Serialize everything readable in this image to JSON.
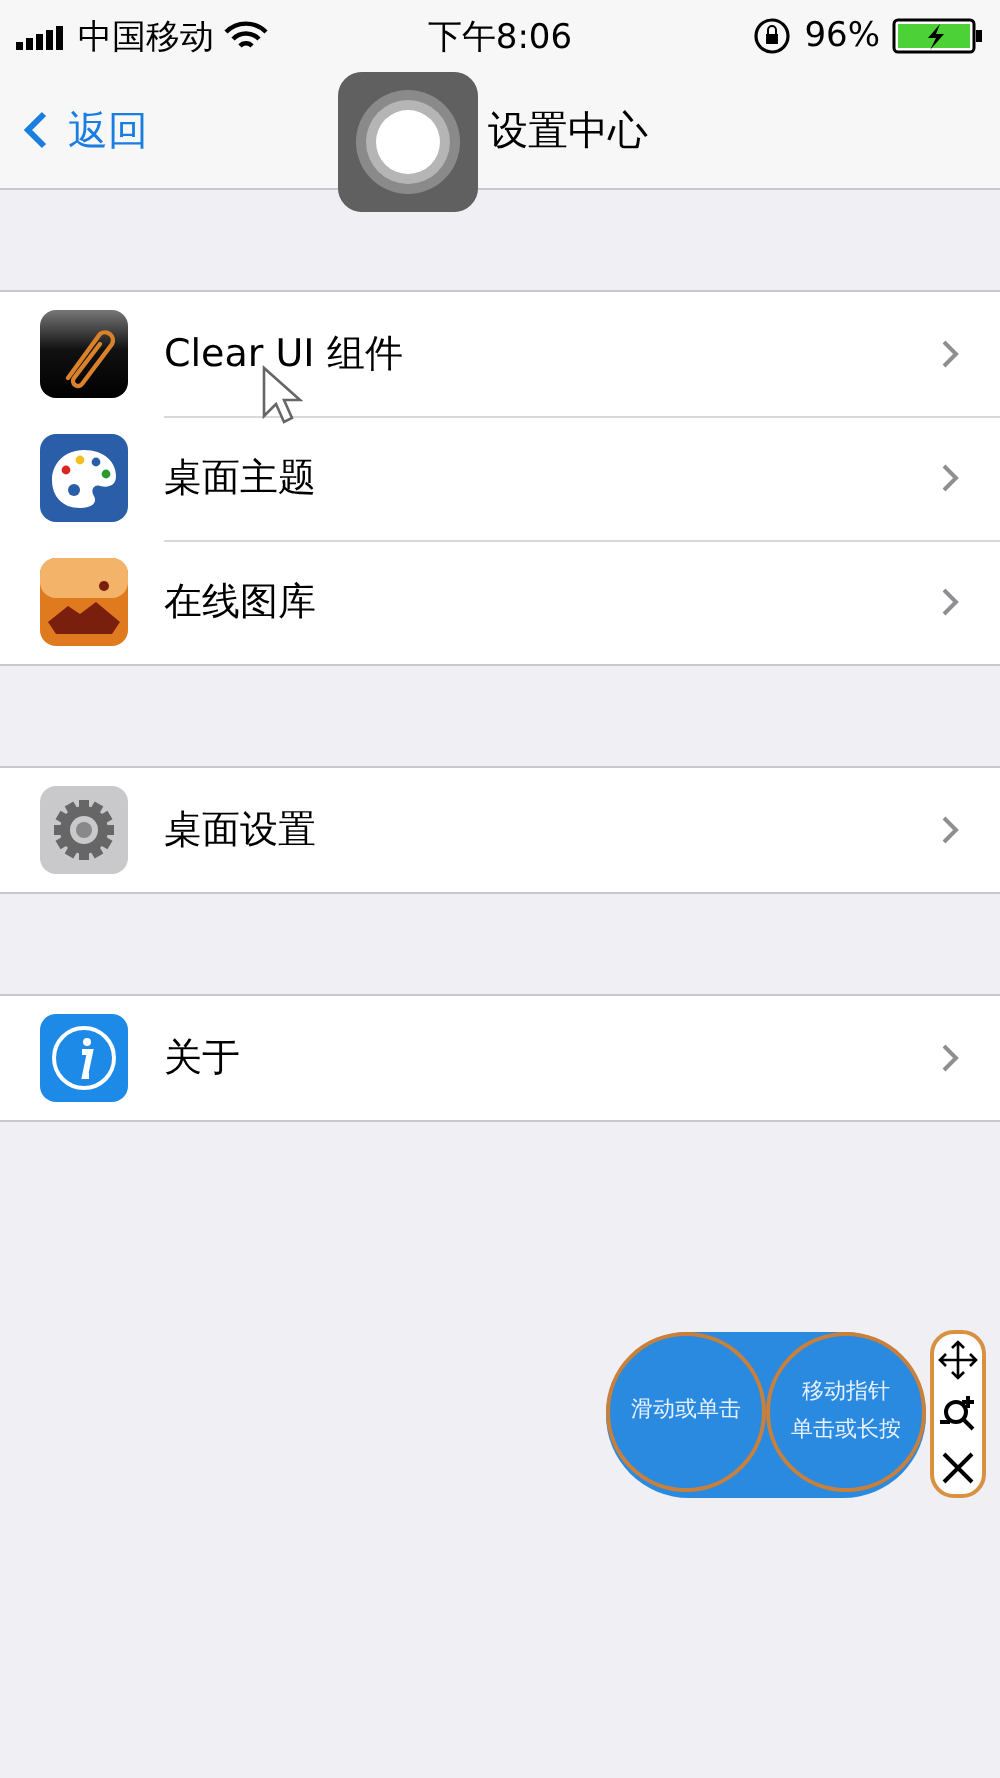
{
  "status_bar": {
    "carrier": "中国移动",
    "time": "下午8:06",
    "battery": "96%"
  },
  "nav_bar": {
    "back": "返回",
    "title": "设置中心"
  },
  "groups": [
    [
      {
        "label": "Clear UI 组件",
        "kind": "clip"
      },
      {
        "label": "桌面主题",
        "kind": "palette"
      },
      {
        "label": "在线图库",
        "kind": "gallery"
      }
    ],
    [
      {
        "label": "桌面设置",
        "kind": "gear"
      }
    ],
    [
      {
        "label": "关于",
        "kind": "info"
      }
    ]
  ],
  "float_panel": {
    "buttons": [
      {
        "lines": [
          "滑动或单击"
        ]
      },
      {
        "lines": [
          "移动指针",
          "单击或长按"
        ]
      }
    ]
  }
}
